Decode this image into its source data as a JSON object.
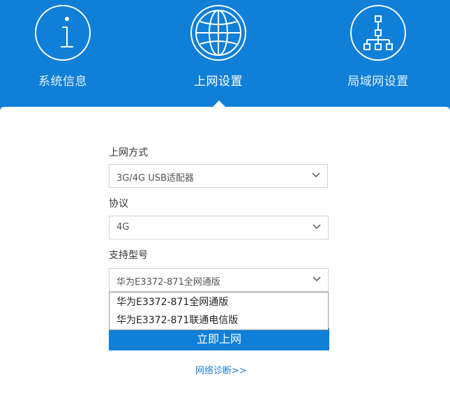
{
  "nav": {
    "items": [
      {
        "label": "系统信息",
        "icon": "info-icon"
      },
      {
        "label": "上网设置",
        "icon": "globe-icon",
        "active": true
      },
      {
        "label": "局域网设置",
        "icon": "network-tree-icon"
      }
    ]
  },
  "form": {
    "connection_type": {
      "label": "上网方式",
      "value": "3G/4G USB适配器"
    },
    "protocol": {
      "label": "协议",
      "value": "4G"
    },
    "model": {
      "label": "支持型号",
      "value": "华为E3372-871全网通版",
      "options": [
        "华为E3372-871全网通版",
        "华为E3372-871联通电信版"
      ]
    },
    "connect_label": "立即上网",
    "diagnose_label": "网络诊断>>"
  },
  "colors": {
    "primary": "#0f7fd8",
    "link": "#1a7fd6",
    "header_text": "#ffffff"
  }
}
